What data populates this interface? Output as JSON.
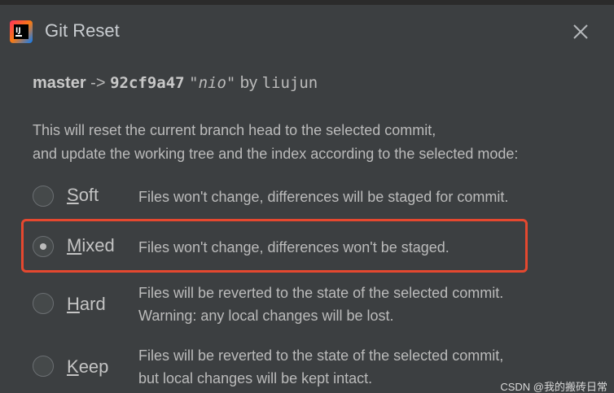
{
  "window": {
    "title": "Git Reset",
    "icon": "intellij-idea-icon",
    "close_icon": "close-icon"
  },
  "commit": {
    "branch": "master",
    "arrow": "->",
    "hash": "92cf9a47",
    "message": "\"nio\"",
    "by": "by",
    "author": "liujun"
  },
  "description": {
    "line1": "This will reset the current branch head to the selected commit,",
    "line2": "and update the working tree and the index according to the selected mode:"
  },
  "options": [
    {
      "mnemonic": "S",
      "rest": "oft",
      "desc1": "Files won't change, differences will be staged for commit.",
      "desc2": "",
      "selected": false
    },
    {
      "mnemonic": "M",
      "rest": "ixed",
      "desc1": "Files won't change, differences won't be staged.",
      "desc2": "",
      "selected": true
    },
    {
      "mnemonic": "H",
      "rest": "ard",
      "desc1": "Files will be reverted to the state of the selected commit.",
      "desc2": "Warning: any local changes will be lost.",
      "selected": false
    },
    {
      "mnemonic": "K",
      "rest": "eep",
      "desc1": "Files will be reverted to the state of the selected commit,",
      "desc2": "but local changes will be kept intact.",
      "selected": false
    }
  ],
  "colors": {
    "background": "#3c3f41",
    "text": "#bbbbbb",
    "highlight": "#e5482f"
  },
  "watermark": "CSDN @我的搬砖日常"
}
